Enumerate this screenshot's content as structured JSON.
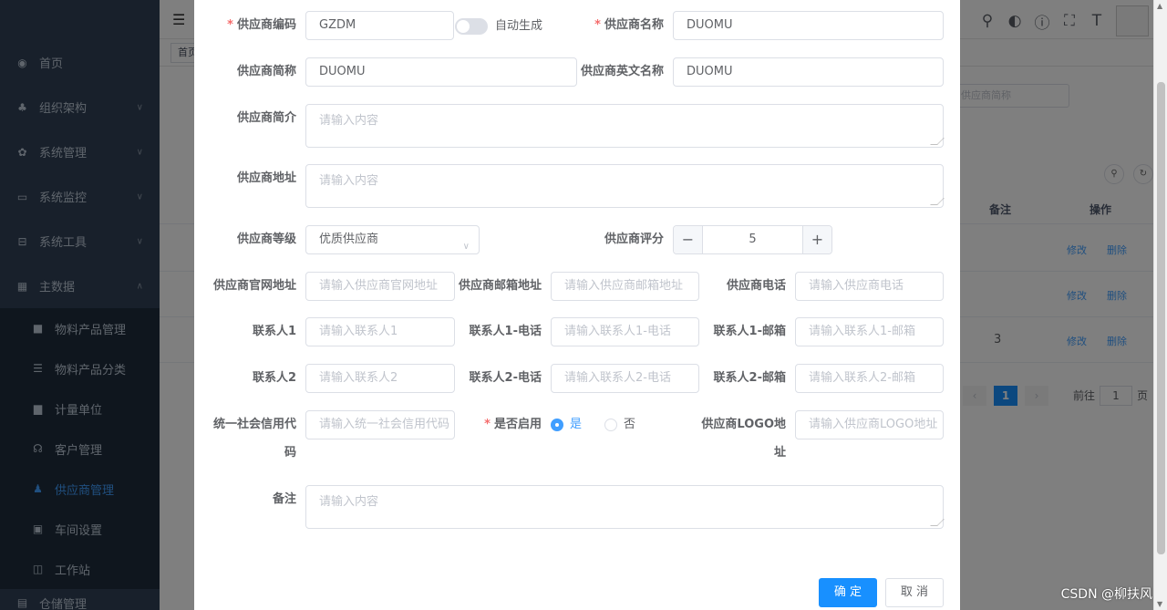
{
  "sidebar": {
    "items": [
      {
        "label": "首页",
        "icon": "dashboard-icon"
      },
      {
        "label": "组织架构",
        "icon": "tree-icon"
      },
      {
        "label": "系统管理",
        "icon": "gear-icon"
      },
      {
        "label": "系统监控",
        "icon": "monitor-icon"
      },
      {
        "label": "系统工具",
        "icon": "toolbox-icon"
      },
      {
        "label": "主数据",
        "icon": "table-icon"
      }
    ],
    "sub_items": [
      {
        "label": "物料产品管理"
      },
      {
        "label": "物料产品分类"
      },
      {
        "label": "计量单位"
      },
      {
        "label": "客户管理"
      },
      {
        "label": "供应商管理"
      },
      {
        "label": "车间设置"
      },
      {
        "label": "工作站"
      }
    ],
    "partial_item": "仓储管理"
  },
  "tags": {
    "first": "首页"
  },
  "background": {
    "search_placeholder": "供应商简称",
    "columns": {
      "note": "备注",
      "actions": "操作"
    },
    "edit_label": "修改",
    "delete_label": "删除",
    "row_note": "3",
    "pagination": {
      "current": "1",
      "goto_label": "前往",
      "page_input": "1",
      "page_suffix": "页"
    }
  },
  "form": {
    "code": {
      "label": "供应商编码",
      "value": "GZDM",
      "auto_label": "自动生成"
    },
    "name": {
      "label": "供应商名称",
      "value": "DUOMU"
    },
    "short_name": {
      "label": "供应商简称",
      "value": "DUOMU"
    },
    "en_name": {
      "label": "供应商英文名称",
      "value": "DUOMU"
    },
    "intro": {
      "label": "供应商简介",
      "placeholder": "请输入内容"
    },
    "address": {
      "label": "供应商地址",
      "placeholder": "请输入内容"
    },
    "level": {
      "label": "供应商等级",
      "value": "优质供应商"
    },
    "score": {
      "label": "供应商评分",
      "value": "5",
      "minus": "−",
      "plus": "+"
    },
    "website": {
      "label": "供应商官网地址",
      "placeholder": "请输入供应商官网地址"
    },
    "email": {
      "label": "供应商邮箱地址",
      "placeholder": "请输入供应商邮箱地址"
    },
    "phone": {
      "label": "供应商电话",
      "placeholder": "请输入供应商电话"
    },
    "contact1": {
      "label": "联系人1",
      "placeholder": "请输入联系人1"
    },
    "contact1_tel": {
      "label": "联系人1-电话",
      "placeholder": "请输入联系人1-电话"
    },
    "contact1_mail": {
      "label": "联系人1-邮箱",
      "placeholder": "请输入联系人1-邮箱"
    },
    "contact2": {
      "label": "联系人2",
      "placeholder": "请输入联系人2"
    },
    "contact2_tel": {
      "label": "联系人2-电话",
      "placeholder": "请输入联系人2-电话"
    },
    "contact2_mail": {
      "label": "联系人2-邮箱",
      "placeholder": "请输入联系人2-邮箱"
    },
    "credit_code": {
      "label_line1": "统一社会信用代",
      "label_line2": "码",
      "placeholder": "请输入统一社会信用代码"
    },
    "enabled": {
      "label": "是否启用",
      "yes": "是",
      "no": "否",
      "selected": "是"
    },
    "logo": {
      "label_line1": "供应商LOGO地",
      "label_line2": "址",
      "placeholder": "请输入供应商LOGO地址"
    },
    "remark": {
      "label": "备注",
      "placeholder": "请输入内容"
    }
  },
  "footer": {
    "confirm": "确 定",
    "cancel": "取 消"
  },
  "watermark": "CSDN @柳扶风",
  "colors": {
    "primary": "#1890ff",
    "sidebar": "#304156",
    "required": "#f56c6c"
  }
}
